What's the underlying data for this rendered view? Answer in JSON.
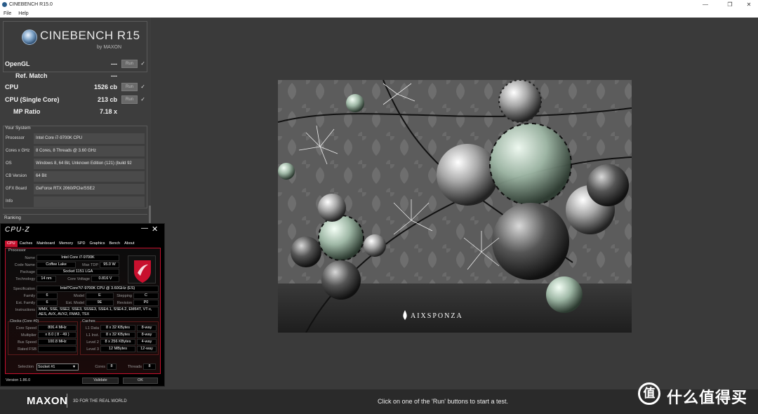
{
  "window": {
    "title": "CINEBENCH R15.0",
    "minimize": "—",
    "maximize": "❐",
    "close": "✕"
  },
  "menu": {
    "file": "File",
    "help": "Help"
  },
  "logo": {
    "name": "CINEBENCH R15",
    "sub": "by MAXON"
  },
  "scores": [
    {
      "label": "OpenGL",
      "value": "---",
      "run": "Run",
      "check": "✓"
    },
    {
      "label": "Ref. Match",
      "value": "---"
    },
    {
      "label": "CPU",
      "value": "1526 cb",
      "run": "Run",
      "check": "✓"
    },
    {
      "label": "CPU (Single Core)",
      "value": "213 cb",
      "run": "Run",
      "check": "✓"
    },
    {
      "label": "MP Ratio",
      "value": "7.18 x"
    }
  ],
  "system": {
    "heading": "Your System",
    "rows": [
      {
        "key": "Processor",
        "value": "Intel Core i7-9700K CPU"
      },
      {
        "key": "Cores x GHz",
        "value": "8 Cores, 8 Threads @ 3.60 GHz"
      },
      {
        "key": "OS",
        "value": "Windows 8, 64 Bit, Unknown Edition (121) (build 92"
      },
      {
        "key": "CB Version",
        "value": "64 Bit"
      },
      {
        "key": "GFX Board",
        "value": "GeForce RTX 2060/PCIe/SSE2"
      },
      {
        "key": "Info",
        "value": ""
      }
    ]
  },
  "ranking": {
    "heading": "Ranking"
  },
  "cpuz": {
    "title": "CPU-Z",
    "tabs": [
      "CPU",
      "Caches",
      "Mainboard",
      "Memory",
      "SPD",
      "Graphics",
      "Bench",
      "About"
    ],
    "processor_group": "Processor",
    "name_label": "Name",
    "name": "Intel Core i7-9700K",
    "codename_label": "Code Name",
    "codename": "Coffee Lake",
    "maxtdp_label": "Max TDP",
    "maxtdp": "95.0 W",
    "package_label": "Package",
    "package": "Socket 1151 LGA",
    "technology_label": "Technology",
    "technology": "14 nm",
    "corevoltage_label": "Core Voltage",
    "corevoltage": "0.816 V",
    "spec_label": "Specification",
    "spec": "Intel?Core?i7-9700K CPU @ 3.60GHz (ES)",
    "family_label": "Family",
    "family": "6",
    "model_label": "Model",
    "model": "E",
    "stepping_label": "Stepping",
    "stepping": "C",
    "extfamily_label": "Ext. Family",
    "extfamily": "6",
    "extmodel_label": "Ext. Model",
    "extmodel": "9E",
    "revision_label": "Revision",
    "revision": "P0",
    "instr_label": "Instructions",
    "instr": "MMX, SSE, SSE2, SSE3, SSSE3, SSE4.1, SSE4.2, EM64T, VT-x, AES, AVX, AVX2, FMA3, TSX",
    "clocks_group": "Clocks (Core #0)",
    "corespeed_label": "Core Speed",
    "corespeed": "806.4 MHz",
    "multiplier_label": "Multiplier",
    "multiplier": "x 8.0 ( 8 - 49 )",
    "busspeed_label": "Bus Speed",
    "busspeed": "100.8 MHz",
    "ratedfsb_label": "Rated FSB",
    "ratedfsb": "",
    "caches_group": "Caches",
    "l1d_label": "L1 Data",
    "l1d": "8 x 32 KBytes",
    "l1d_way": "8-way",
    "l1i_label": "L1 Inst.",
    "l1i": "8 x 32 KBytes",
    "l1i_way": "8-way",
    "l2_label": "Level 2",
    "l2": "8 x 256 KBytes",
    "l2_way": "4-way",
    "l3_label": "Level 3",
    "l3": "12 MBytes",
    "l3_way": "12-way",
    "selection_label": "Selection",
    "selection": "Socket #1",
    "cores_label": "Cores",
    "cores": "8",
    "threads_label": "Threads",
    "threads": "8",
    "version": "Version 1.86.0",
    "validate": "Validate",
    "ok": "OK"
  },
  "render": {
    "brand": "AIXSPONZA"
  },
  "footer": {
    "maxon": "MAXON",
    "tagline": "3D FOR THE REAL WORLD",
    "message": "Click on one of the 'Run' buttons to start a test.",
    "watermark_glyph": "值",
    "watermark_text": "什么值得买"
  },
  "colors": {
    "accent": "#c8102e",
    "panel": "#3d3d3d",
    "background": "#3a3a3a"
  }
}
